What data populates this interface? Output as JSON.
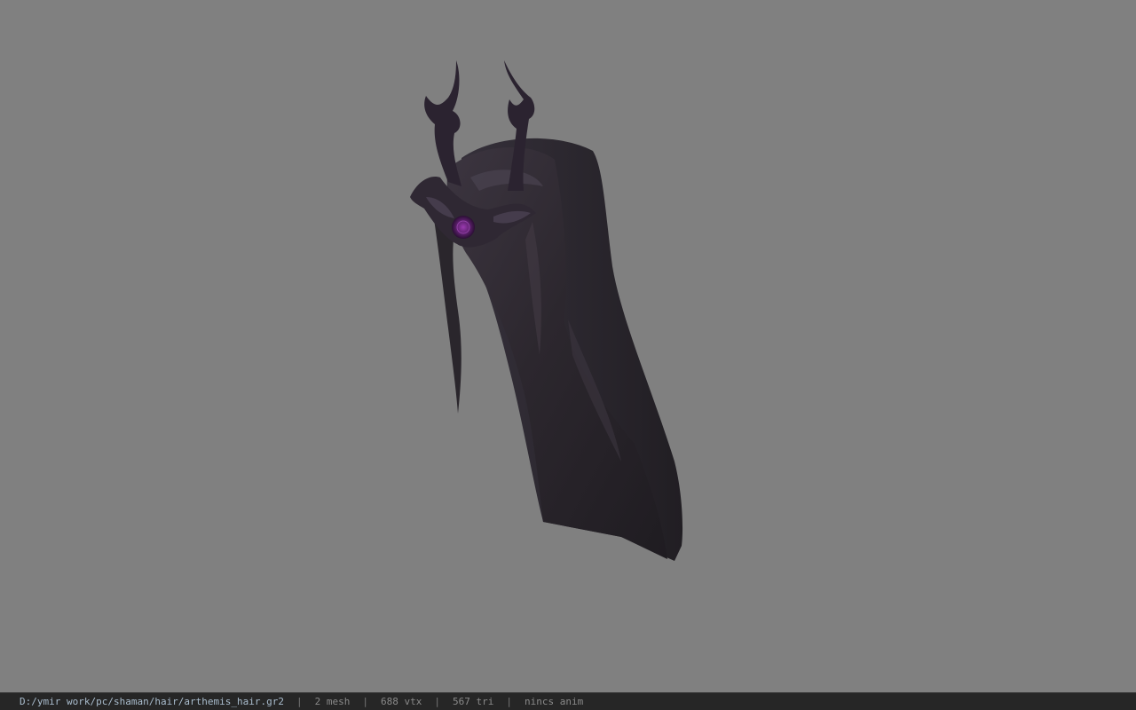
{
  "viewer": {
    "background_color": "#808080",
    "model_name": "arthemis_hair"
  },
  "status": {
    "path": "D:/ymir work/pc/shaman/hair/arthemis_hair.gr2",
    "mesh": "2 mesh",
    "vtx": "688 vtx",
    "tri": "567 tri",
    "anim": "nincs anim",
    "separator": "|"
  }
}
